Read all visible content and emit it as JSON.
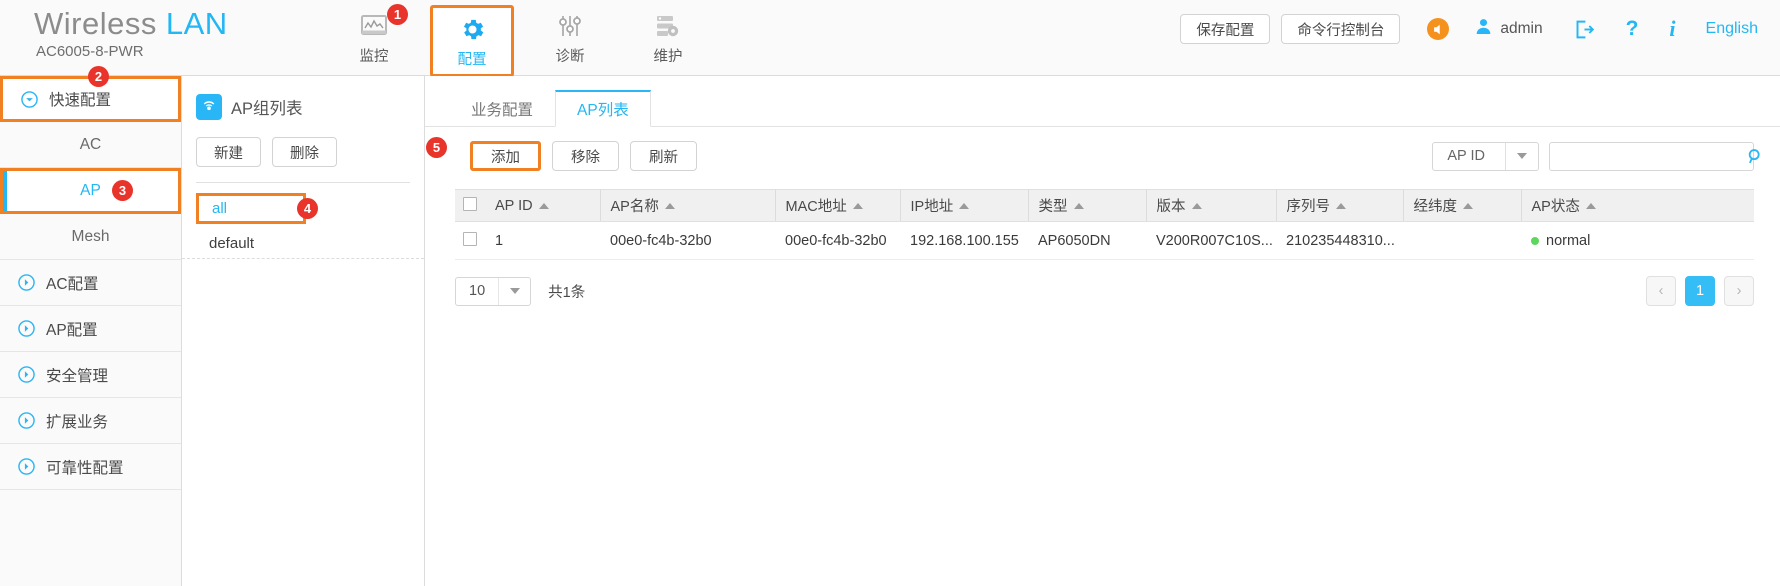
{
  "header": {
    "brand_word1": "Wireless",
    "brand_word2": "LAN",
    "model": "AC6005-8-PWR",
    "nav": [
      {
        "label": "监控",
        "icon": "monitor-icon",
        "badge": "1",
        "active": false
      },
      {
        "label": "配置",
        "icon": "gear-icon",
        "badge": "",
        "active": true
      },
      {
        "label": "诊断",
        "icon": "sliders-icon",
        "badge": "",
        "active": false
      },
      {
        "label": "维护",
        "icon": "maintenance-icon",
        "badge": "",
        "active": false
      }
    ],
    "save_config_label": "保存配置",
    "cli_console_label": "命令行控制台",
    "user_name": "admin",
    "language_label": "English",
    "accent_color": "#23b7f3",
    "highlight_color": "#f08021"
  },
  "sidebar": {
    "items": [
      {
        "label": "快速配置",
        "type": "group",
        "expanded": true,
        "boxed": true,
        "badge": "2"
      },
      {
        "label": "AC",
        "type": "sub",
        "active": false,
        "boxed": false,
        "badge": ""
      },
      {
        "label": "AP",
        "type": "sub",
        "active": true,
        "boxed": true,
        "badge": "3"
      },
      {
        "label": "Mesh",
        "type": "sub",
        "active": false,
        "boxed": false,
        "badge": ""
      },
      {
        "label": "AC配置",
        "type": "group",
        "expanded": false,
        "boxed": false,
        "badge": ""
      },
      {
        "label": "AP配置",
        "type": "group",
        "expanded": false,
        "boxed": false,
        "badge": ""
      },
      {
        "label": "安全管理",
        "type": "group",
        "expanded": false,
        "boxed": false,
        "badge": ""
      },
      {
        "label": "扩展业务",
        "type": "group",
        "expanded": false,
        "boxed": false,
        "badge": ""
      },
      {
        "label": "可靠性配置",
        "type": "group",
        "expanded": false,
        "boxed": false,
        "badge": ""
      }
    ]
  },
  "group_panel": {
    "title": "AP组列表",
    "new_label": "新建",
    "delete_label": "删除",
    "groups": [
      {
        "name": "all",
        "selected": true,
        "boxed": true,
        "badge": "4"
      },
      {
        "name": "default",
        "selected": false,
        "boxed": false,
        "badge": ""
      }
    ]
  },
  "main": {
    "tabs": [
      {
        "label": "业务配置",
        "active": false
      },
      {
        "label": "AP列表",
        "active": true
      }
    ],
    "toolbar": {
      "add_label": "添加",
      "remove_label": "移除",
      "refresh_label": "刷新",
      "add_badge": "5",
      "filter_field": "AP ID",
      "search_value": "",
      "search_placeholder": ""
    },
    "table": {
      "columns": [
        "AP ID",
        "AP名称",
        "MAC地址",
        "IP地址",
        "类型",
        "版本",
        "序列号",
        "经纬度",
        "AP状态"
      ],
      "rows": [
        {
          "ap_id": "1",
          "ap_name": "00e0-fc4b-32b0",
          "mac": "00e0-fc4b-32b0",
          "ip": "192.168.100.155",
          "type": "AP6050DN",
          "version": "V200R007C10S...",
          "serial": "210235448310...",
          "geo": "",
          "status": "normal",
          "status_color": "#5cd65c"
        }
      ]
    },
    "footer": {
      "page_size": "10",
      "total_text": "共1条",
      "prev_label": "‹",
      "next_label": "›",
      "pages": [
        "1"
      ],
      "current_page": "1"
    }
  }
}
